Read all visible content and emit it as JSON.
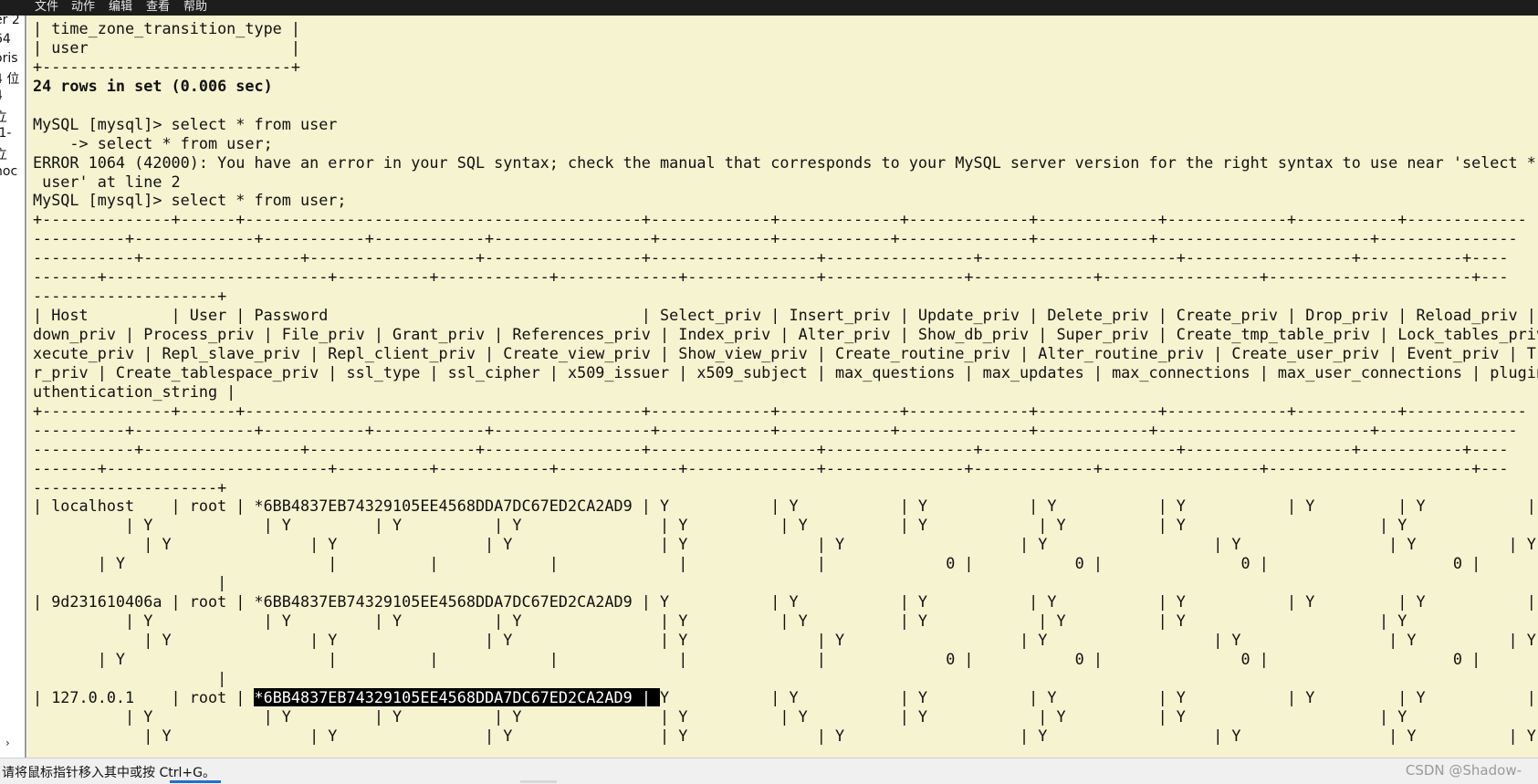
{
  "menubar": {
    "items": [
      "文件",
      "动作",
      "编辑",
      "查看",
      "帮助"
    ]
  },
  "left_panel": {
    "fragments": [
      "er 2",
      "64",
      "oris",
      "4 位",
      "4",
      "立",
      ".1-",
      "立",
      "noc"
    ]
  },
  "terminal": {
    "lines": [
      {
        "text": "| time_zone_transition_type |"
      },
      {
        "text": "| user                      |"
      },
      {
        "text": "+---------------------------+"
      },
      {
        "text": "24 rows in set (0.006 sec)",
        "bold": true
      },
      {
        "text": ""
      },
      {
        "text": "MySQL [mysql]> select * from user"
      },
      {
        "text": "    -> select * from user;"
      },
      {
        "text": "ERROR 1064 (42000): You have an error in your SQL syntax; check the manual that corresponds to your MySQL server version for the right syntax to use near 'select * f"
      },
      {
        "text": " user' at line 2"
      },
      {
        "text": "MySQL [mysql]> select * from user;"
      },
      {
        "text": "+--------------+------+-------------------------------------------+-------------+-------------+-------------+-------------+-------------+-----------+-------------"
      },
      {
        "text": "----------+-------------+-----------+------------+-----------------+------------+------------+--------------+------------+-----------------------+---------------"
      },
      {
        "text": "-----------+-----------------+------------------+-----------------+------------------+----------------+---------------------+------------------+-----------+----"
      },
      {
        "text": "-------+------------------------+----------+------------+-------------+--------------+---------------+-------------+-----------------+----------------------+---"
      },
      {
        "text": "--------------------+"
      },
      {
        "text": "| Host         | User | Password                                  | Select_priv | Insert_priv | Update_priv | Delete_priv | Create_priv | Drop_priv | Reload_priv | S"
      },
      {
        "text": "down_priv | Process_priv | File_priv | Grant_priv | References_priv | Index_priv | Alter_priv | Show_db_priv | Super_priv | Create_tmp_table_priv | Lock_tables_priv"
      },
      {
        "text": "xecute_priv | Repl_slave_priv | Repl_client_priv | Create_view_priv | Show_view_priv | Create_routine_priv | Alter_routine_priv | Create_user_priv | Event_priv | Tri"
      },
      {
        "text": "r_priv | Create_tablespace_priv | ssl_type | ssl_cipher | x509_issuer | x509_subject | max_questions | max_updates | max_connections | max_user_connections | plugin"
      },
      {
        "text": "uthentication_string |"
      },
      {
        "text": "+--------------+------+-------------------------------------------+-------------+-------------+-------------+-------------+-------------+-----------+-------------"
      },
      {
        "text": "----------+-------------+-----------+------------+-----------------+------------+------------+--------------+------------+-----------------------+---------------"
      },
      {
        "text": "-----------+-----------------+------------------+-----------------+------------------+----------------+---------------------+------------------+-----------+----"
      },
      {
        "text": "-------+------------------------+----------+------------+-------------+--------------+---------------+-------------+-----------------+----------------------+---"
      },
      {
        "text": "--------------------+"
      },
      {
        "text": "| localhost    | root | *6BB4837EB74329105EE4568DDA7DC67ED2CA2AD9 | Y           | Y           | Y           | Y           | Y           | Y         | Y           | Y"
      },
      {
        "text": "          | Y            | Y         | Y          | Y               | Y          | Y          | Y            | Y          | Y                     | Y"
      },
      {
        "text": "            | Y               | Y                | Y                | Y              | Y                   | Y                  | Y                | Y          | Y"
      },
      {
        "text": "       | Y                      |          |            |             |              |             0 |           0 |               0 |                    0 |"
      },
      {
        "text": "                    |"
      },
      {
        "text": "| 9d231610406a | root | *6BB4837EB74329105EE4568DDA7DC67ED2CA2AD9 | Y           | Y           | Y           | Y           | Y           | Y         | Y           | Y"
      },
      {
        "text": "          | Y            | Y         | Y          | Y               | Y          | Y          | Y            | Y          | Y                     | Y"
      },
      {
        "text": "            | Y               | Y                | Y                | Y              | Y                   | Y                  | Y                | Y          | Y"
      },
      {
        "text": "       | Y                      |          |            |             |              |             0 |           0 |               0 |                    0 |"
      },
      {
        "text": "                    |"
      },
      {
        "text": "| 127.0.0.1    | root | ",
        "highlight": "*6BB4837EB74329105EE4568DDA7DC67ED2CA2AD9 | ",
        "after": "Y           | Y           | Y           | Y           | Y           | Y         | Y           | Y"
      },
      {
        "text": "          | Y            | Y         | Y          | Y               | Y          | Y          | Y            | Y          | Y                     | Y"
      },
      {
        "text": "            | Y               | Y                | Y                | Y              | Y                   | Y                  | Y                | Y          | Y"
      }
    ]
  },
  "statusbar": {
    "text": "请将鼠标指针移入其中或按 Ctrl+G。",
    "watermark": "CSDN @Shadow-"
  },
  "colors": {
    "terminal_bg": "#f5f3d0",
    "menubar_bg": "#1d1d1d",
    "highlight_bg": "#000000"
  }
}
